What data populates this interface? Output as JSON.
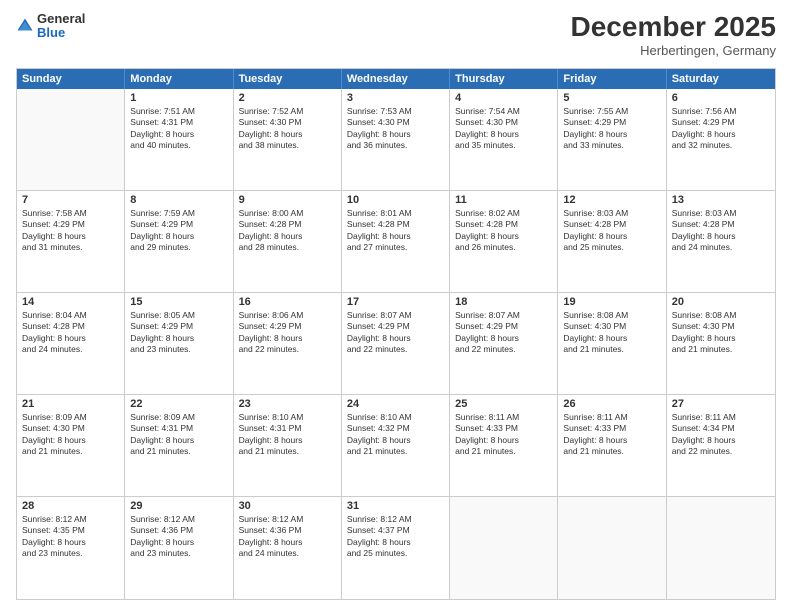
{
  "logo": {
    "general": "General",
    "blue": "Blue"
  },
  "title": "December 2025",
  "location": "Herbertingen, Germany",
  "header_days": [
    "Sunday",
    "Monday",
    "Tuesday",
    "Wednesday",
    "Thursday",
    "Friday",
    "Saturday"
  ],
  "weeks": [
    [
      {
        "day": "",
        "info": ""
      },
      {
        "day": "1",
        "info": "Sunrise: 7:51 AM\nSunset: 4:31 PM\nDaylight: 8 hours\nand 40 minutes."
      },
      {
        "day": "2",
        "info": "Sunrise: 7:52 AM\nSunset: 4:30 PM\nDaylight: 8 hours\nand 38 minutes."
      },
      {
        "day": "3",
        "info": "Sunrise: 7:53 AM\nSunset: 4:30 PM\nDaylight: 8 hours\nand 36 minutes."
      },
      {
        "day": "4",
        "info": "Sunrise: 7:54 AM\nSunset: 4:30 PM\nDaylight: 8 hours\nand 35 minutes."
      },
      {
        "day": "5",
        "info": "Sunrise: 7:55 AM\nSunset: 4:29 PM\nDaylight: 8 hours\nand 33 minutes."
      },
      {
        "day": "6",
        "info": "Sunrise: 7:56 AM\nSunset: 4:29 PM\nDaylight: 8 hours\nand 32 minutes."
      }
    ],
    [
      {
        "day": "7",
        "info": "Sunrise: 7:58 AM\nSunset: 4:29 PM\nDaylight: 8 hours\nand 31 minutes."
      },
      {
        "day": "8",
        "info": "Sunrise: 7:59 AM\nSunset: 4:29 PM\nDaylight: 8 hours\nand 29 minutes."
      },
      {
        "day": "9",
        "info": "Sunrise: 8:00 AM\nSunset: 4:28 PM\nDaylight: 8 hours\nand 28 minutes."
      },
      {
        "day": "10",
        "info": "Sunrise: 8:01 AM\nSunset: 4:28 PM\nDaylight: 8 hours\nand 27 minutes."
      },
      {
        "day": "11",
        "info": "Sunrise: 8:02 AM\nSunset: 4:28 PM\nDaylight: 8 hours\nand 26 minutes."
      },
      {
        "day": "12",
        "info": "Sunrise: 8:03 AM\nSunset: 4:28 PM\nDaylight: 8 hours\nand 25 minutes."
      },
      {
        "day": "13",
        "info": "Sunrise: 8:03 AM\nSunset: 4:28 PM\nDaylight: 8 hours\nand 24 minutes."
      }
    ],
    [
      {
        "day": "14",
        "info": "Sunrise: 8:04 AM\nSunset: 4:28 PM\nDaylight: 8 hours\nand 24 minutes."
      },
      {
        "day": "15",
        "info": "Sunrise: 8:05 AM\nSunset: 4:29 PM\nDaylight: 8 hours\nand 23 minutes."
      },
      {
        "day": "16",
        "info": "Sunrise: 8:06 AM\nSunset: 4:29 PM\nDaylight: 8 hours\nand 22 minutes."
      },
      {
        "day": "17",
        "info": "Sunrise: 8:07 AM\nSunset: 4:29 PM\nDaylight: 8 hours\nand 22 minutes."
      },
      {
        "day": "18",
        "info": "Sunrise: 8:07 AM\nSunset: 4:29 PM\nDaylight: 8 hours\nand 22 minutes."
      },
      {
        "day": "19",
        "info": "Sunrise: 8:08 AM\nSunset: 4:30 PM\nDaylight: 8 hours\nand 21 minutes."
      },
      {
        "day": "20",
        "info": "Sunrise: 8:08 AM\nSunset: 4:30 PM\nDaylight: 8 hours\nand 21 minutes."
      }
    ],
    [
      {
        "day": "21",
        "info": "Sunrise: 8:09 AM\nSunset: 4:30 PM\nDaylight: 8 hours\nand 21 minutes."
      },
      {
        "day": "22",
        "info": "Sunrise: 8:09 AM\nSunset: 4:31 PM\nDaylight: 8 hours\nand 21 minutes."
      },
      {
        "day": "23",
        "info": "Sunrise: 8:10 AM\nSunset: 4:31 PM\nDaylight: 8 hours\nand 21 minutes."
      },
      {
        "day": "24",
        "info": "Sunrise: 8:10 AM\nSunset: 4:32 PM\nDaylight: 8 hours\nand 21 minutes."
      },
      {
        "day": "25",
        "info": "Sunrise: 8:11 AM\nSunset: 4:33 PM\nDaylight: 8 hours\nand 21 minutes."
      },
      {
        "day": "26",
        "info": "Sunrise: 8:11 AM\nSunset: 4:33 PM\nDaylight: 8 hours\nand 21 minutes."
      },
      {
        "day": "27",
        "info": "Sunrise: 8:11 AM\nSunset: 4:34 PM\nDaylight: 8 hours\nand 22 minutes."
      }
    ],
    [
      {
        "day": "28",
        "info": "Sunrise: 8:12 AM\nSunset: 4:35 PM\nDaylight: 8 hours\nand 23 minutes."
      },
      {
        "day": "29",
        "info": "Sunrise: 8:12 AM\nSunset: 4:36 PM\nDaylight: 8 hours\nand 23 minutes."
      },
      {
        "day": "30",
        "info": "Sunrise: 8:12 AM\nSunset: 4:36 PM\nDaylight: 8 hours\nand 24 minutes."
      },
      {
        "day": "31",
        "info": "Sunrise: 8:12 AM\nSunset: 4:37 PM\nDaylight: 8 hours\nand 25 minutes."
      },
      {
        "day": "",
        "info": ""
      },
      {
        "day": "",
        "info": ""
      },
      {
        "day": "",
        "info": ""
      }
    ]
  ]
}
